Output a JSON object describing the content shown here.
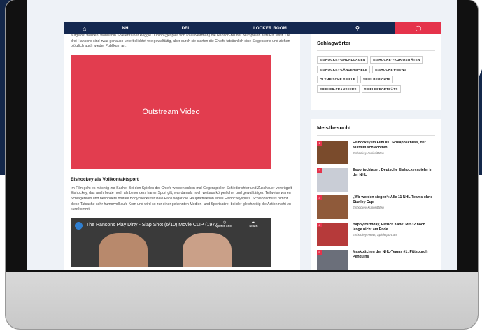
{
  "nav": {
    "home_icon": "home-icon",
    "items": [
      "NHL",
      "DEL",
      "LOCKER ROOM"
    ],
    "search_icon": "search-icon",
    "globe_icon": "globe-icon"
  },
  "article": {
    "intro_text": "aufgelöst werden, woraufhin Spielertrainer Reggie Dunlop (gespielt von Paul Newman) die Hanson-Brüder bei Spielen aufs Eis lässt. Die drei Hansons sind zwar genauso unterbelichtet wie gewalttätig, aber durch sie starten die Chiefs tatsächlich eine Siegesserie und ziehen plötzlich auch wieder Publikum an.",
    "video_label": "Outstream Video",
    "section_heading": "Eishockey als Vollkontaktsport",
    "section_text": "Im Film geht es mächtig zur Sache. Bei den Spielen der Chiefs werden schon mal Gegenspieler, Schiedsrichter und Zuschauer verprügelt. Eishockey, das auch heute noch als besonders harter Sport gilt, war damals noch weitaus körperlicher und gewalttätiger. Teilweise waren Schlägereien und besonders brutale Bodychecks für viele Fans sogar die Hauptattraktion eines Eishockeyspiels. Schlappschuss nimmt diese Tatsache sehr humorvoll aufs Korn und wird so zur einer gekonnten Medien- und Sportsatire, bei der gleichzeitig die Action nicht zu kurz kommt.",
    "youtube": {
      "title": "The Hansons Play Dirty - Slap Shot (6/10) Movie CLIP (1977...",
      "watch_later": "Später ans...",
      "share": "Teilen"
    }
  },
  "sidebar": {
    "tags_title": "Schlagwörter",
    "tags": [
      "EISHOCKEY-GRUNDLAGEN",
      "EISHOCKEY-KURIOSITÄTEN",
      "EISHOCKEY-LÄNDERSPIELE",
      "EISHOCKEY-NEWS",
      "OLYMPISCHE SPIELE",
      "SPIELBERICHTE",
      "SPIELER-TRANSFERS",
      "SPIELERPORTRÄTS"
    ],
    "popular_title": "Meistbesucht",
    "popular": [
      {
        "num": "1",
        "title": "Eishockey im Film #1: Schlappschuss, der Kultfilm schlechthin",
        "cat": "Eishockey-Kuriositäten",
        "color": "#7a4b2c"
      },
      {
        "num": "2",
        "title": "Exportschlager: Deutsche Eishockeyspieler in der NHL",
        "cat": "",
        "color": "#c9cdd6"
      },
      {
        "num": "3",
        "title": "„Wir werden siegen“: Alle 11 NHL-Teams ohne Stanley Cup",
        "cat": "Eishockey-Kuriositäten",
        "color": "#8f5a3a"
      },
      {
        "num": "4",
        "title": "Happy Birthday, Patrick Kane: Mit 32 noch lange nicht am Ende",
        "cat": "Eishockey-News, Spielerporträts",
        "color": "#b63a3a"
      },
      {
        "num": "5",
        "title": "Maskottchen der NHL-Teams #1: Pittsburgh Penguins",
        "cat": "",
        "color": "#6b6f7a"
      }
    ]
  },
  "colors": {
    "nav_bg": "#142850",
    "accent_red": "#e5334b",
    "video_red": "#e23d4f"
  }
}
